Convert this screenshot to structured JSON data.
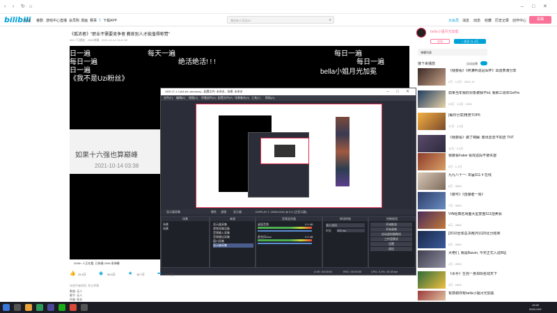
{
  "nav": {
    "items": [
      "主站",
      "番剧",
      "游戏中心",
      "直播",
      "会员购",
      "漫画",
      "赛事"
    ],
    "download": "下载APP",
    "search_placeholder": "我还有人活法么?",
    "right_items": [
      "大会员",
      "消息",
      "动态",
      "收藏",
      "历史记录",
      "创作中心"
    ],
    "contribute": "投稿"
  },
  "video": {
    "title": "《孤浓者》\"职业不需要竞争者 教练别人才能值得称赞\"",
    "meta": "382.7万播放 · 2098弹幕 · 2021-10-14 15:41:59",
    "barrages": [
      "日一遍",
      "每天一遍",
      "每日一遍",
      "每日一遍",
      "每日一遍",
      "绝活绝活! ! !",
      "日一遍",
      "bella小姐月光加冕",
      "《我不是Uzi粉丝》"
    ],
    "popup_text": "如果十六强也算巅峰",
    "popup_time": "2021-10-14 03:38",
    "footer": "2098+ 人正在看, 已装填 2098 条弹幕",
    "actions": [
      {
        "icon": "like-icon",
        "label": "41.5万"
      },
      {
        "icon": "coin-icon",
        "label": "34.5万"
      },
      {
        "icon": "favorite-icon",
        "label": "16.7万"
      },
      {
        "icon": "share-icon",
        "label": "22.3万"
      }
    ],
    "notice": "未经作者授权, 禁止转载",
    "info_lines": [
      "歌曲: 无人",
      "歌手: 无人",
      "作曲: 佚名"
    ]
  },
  "obs": {
    "title": "OBS 27.1.3 (64-bit, windows) - 配置文件: 未命名 - 场景: 未命名",
    "menu": [
      "文件(F)",
      "编辑(E)",
      "视图(V)",
      "停靠部件(D)",
      "配置文件(P)",
      "场景集合(S)",
      "工具(T)",
      "帮助(H)"
    ],
    "status_bar": "显示器采集",
    "toolbar": [
      "属性",
      "滤镜",
      "显示器",
      "DISPLAY 1: 2560x1440 @ 0,0 (主显示器)"
    ],
    "panels": [
      "场景",
      "来源",
      "音频混合器",
      "转场特效",
      "控制按钮"
    ],
    "scenes": [
      "场景",
      "场景"
    ],
    "sources": [
      "显示器采集",
      "视频采集设备",
      "音频输入采集",
      "音频输出采集",
      "窗口采集",
      "显示器采集"
    ],
    "mixer": [
      {
        "name": "桌面音频",
        "db": "0.0 dB"
      },
      {
        "name": "麦克风/Aux",
        "db": "0.0 dB"
      }
    ],
    "transition": {
      "type": "淡入淡出",
      "duration_label": "时长",
      "duration": "300 ms"
    },
    "controls": [
      "开始推流",
      "开始录制",
      "启动虚拟摄像机",
      "工作室模式",
      "设置",
      "退出"
    ],
    "footer": [
      "LIVE: 00:00:00",
      "REC: 00:00:00",
      "CPU: 2.2%, 30.00 fps"
    ]
  },
  "sidebar": {
    "uploader": "bella小姐月光加冕",
    "charge_btn": "充电",
    "follow_btn": "+ 关注 31.3万",
    "danmaku_list": "弹幕列表",
    "next_up": "接下来播放",
    "autoplay": "自动连播",
    "recommendations": [
      {
        "title": "《我要看》《阿满听说冠军杯》出道表演分享",
        "meta": "2万 · 1.5万 · 2021-10"
      },
      {
        "title": "如果当年我的对象被我不lol, 我和三周年GoPro",
        "meta": "20万 · 1.5万 · 2021"
      },
      {
        "title": "[每日分享]电竞TOP5",
        "meta": "17万 · 1.3万"
      },
      {
        "title": "《我要看》做了锦解: 要出去去不如去 TNT",
        "meta": "11万 · 1.2万"
      },
      {
        "title": "我要看Faker 看完这段不要失望",
        "meta": "9万 · 1.1万"
      },
      {
        "title": "九九八十一: 本届S11 # 在线",
        "meta": "8万 · 3000"
      },
      {
        "title": "《要可》《自爆者一周》",
        "meta": "7万 · 3000"
      },
      {
        "title": "VIN经典名场面大型复盘S11拍卖会",
        "meta": "6万 · 2800"
      },
      {
        "title": "[2010全球总决赛]与同20比分结果",
        "meta": "5万 · 2600"
      },
      {
        "title": "大佬们, 我是Bacon, 今天正式入驻B站",
        "meta": "4万 · 2000"
      },
      {
        "title": "《水手》生完一身郑阳名动天下",
        "meta": "3万 · 1800"
      },
      {
        "title": "有感谢你有bella小姐月光加冕",
        "meta": "2万 · 1500"
      }
    ]
  },
  "taskbar": {
    "time": "19:40",
    "date": "2021/11/9"
  },
  "colors": {
    "accent": "#00a1d6",
    "pink": "#fb7299",
    "obs_bg": "#2b2e38",
    "obs_highlight": "#e0284e"
  }
}
